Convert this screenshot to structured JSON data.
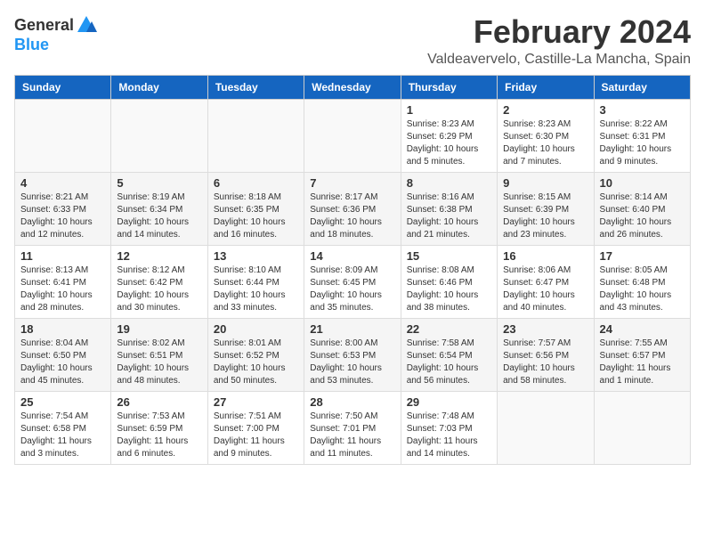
{
  "logo": {
    "general": "General",
    "blue": "Blue"
  },
  "title": "February 2024",
  "location": "Valdeavervelo, Castille-La Mancha, Spain",
  "days_of_week": [
    "Sunday",
    "Monday",
    "Tuesday",
    "Wednesday",
    "Thursday",
    "Friday",
    "Saturday"
  ],
  "weeks": [
    [
      {
        "day": "",
        "info": ""
      },
      {
        "day": "",
        "info": ""
      },
      {
        "day": "",
        "info": ""
      },
      {
        "day": "",
        "info": ""
      },
      {
        "day": "1",
        "info": "Sunrise: 8:23 AM\nSunset: 6:29 PM\nDaylight: 10 hours\nand 5 minutes."
      },
      {
        "day": "2",
        "info": "Sunrise: 8:23 AM\nSunset: 6:30 PM\nDaylight: 10 hours\nand 7 minutes."
      },
      {
        "day": "3",
        "info": "Sunrise: 8:22 AM\nSunset: 6:31 PM\nDaylight: 10 hours\nand 9 minutes."
      }
    ],
    [
      {
        "day": "4",
        "info": "Sunrise: 8:21 AM\nSunset: 6:33 PM\nDaylight: 10 hours\nand 12 minutes."
      },
      {
        "day": "5",
        "info": "Sunrise: 8:19 AM\nSunset: 6:34 PM\nDaylight: 10 hours\nand 14 minutes."
      },
      {
        "day": "6",
        "info": "Sunrise: 8:18 AM\nSunset: 6:35 PM\nDaylight: 10 hours\nand 16 minutes."
      },
      {
        "day": "7",
        "info": "Sunrise: 8:17 AM\nSunset: 6:36 PM\nDaylight: 10 hours\nand 18 minutes."
      },
      {
        "day": "8",
        "info": "Sunrise: 8:16 AM\nSunset: 6:38 PM\nDaylight: 10 hours\nand 21 minutes."
      },
      {
        "day": "9",
        "info": "Sunrise: 8:15 AM\nSunset: 6:39 PM\nDaylight: 10 hours\nand 23 minutes."
      },
      {
        "day": "10",
        "info": "Sunrise: 8:14 AM\nSunset: 6:40 PM\nDaylight: 10 hours\nand 26 minutes."
      }
    ],
    [
      {
        "day": "11",
        "info": "Sunrise: 8:13 AM\nSunset: 6:41 PM\nDaylight: 10 hours\nand 28 minutes."
      },
      {
        "day": "12",
        "info": "Sunrise: 8:12 AM\nSunset: 6:42 PM\nDaylight: 10 hours\nand 30 minutes."
      },
      {
        "day": "13",
        "info": "Sunrise: 8:10 AM\nSunset: 6:44 PM\nDaylight: 10 hours\nand 33 minutes."
      },
      {
        "day": "14",
        "info": "Sunrise: 8:09 AM\nSunset: 6:45 PM\nDaylight: 10 hours\nand 35 minutes."
      },
      {
        "day": "15",
        "info": "Sunrise: 8:08 AM\nSunset: 6:46 PM\nDaylight: 10 hours\nand 38 minutes."
      },
      {
        "day": "16",
        "info": "Sunrise: 8:06 AM\nSunset: 6:47 PM\nDaylight: 10 hours\nand 40 minutes."
      },
      {
        "day": "17",
        "info": "Sunrise: 8:05 AM\nSunset: 6:48 PM\nDaylight: 10 hours\nand 43 minutes."
      }
    ],
    [
      {
        "day": "18",
        "info": "Sunrise: 8:04 AM\nSunset: 6:50 PM\nDaylight: 10 hours\nand 45 minutes."
      },
      {
        "day": "19",
        "info": "Sunrise: 8:02 AM\nSunset: 6:51 PM\nDaylight: 10 hours\nand 48 minutes."
      },
      {
        "day": "20",
        "info": "Sunrise: 8:01 AM\nSunset: 6:52 PM\nDaylight: 10 hours\nand 50 minutes."
      },
      {
        "day": "21",
        "info": "Sunrise: 8:00 AM\nSunset: 6:53 PM\nDaylight: 10 hours\nand 53 minutes."
      },
      {
        "day": "22",
        "info": "Sunrise: 7:58 AM\nSunset: 6:54 PM\nDaylight: 10 hours\nand 56 minutes."
      },
      {
        "day": "23",
        "info": "Sunrise: 7:57 AM\nSunset: 6:56 PM\nDaylight: 10 hours\nand 58 minutes."
      },
      {
        "day": "24",
        "info": "Sunrise: 7:55 AM\nSunset: 6:57 PM\nDaylight: 11 hours\nand 1 minute."
      }
    ],
    [
      {
        "day": "25",
        "info": "Sunrise: 7:54 AM\nSunset: 6:58 PM\nDaylight: 11 hours\nand 3 minutes."
      },
      {
        "day": "26",
        "info": "Sunrise: 7:53 AM\nSunset: 6:59 PM\nDaylight: 11 hours\nand 6 minutes."
      },
      {
        "day": "27",
        "info": "Sunrise: 7:51 AM\nSunset: 7:00 PM\nDaylight: 11 hours\nand 9 minutes."
      },
      {
        "day": "28",
        "info": "Sunrise: 7:50 AM\nSunset: 7:01 PM\nDaylight: 11 hours\nand 11 minutes."
      },
      {
        "day": "29",
        "info": "Sunrise: 7:48 AM\nSunset: 7:03 PM\nDaylight: 11 hours\nand 14 minutes."
      },
      {
        "day": "",
        "info": ""
      },
      {
        "day": "",
        "info": ""
      }
    ]
  ]
}
